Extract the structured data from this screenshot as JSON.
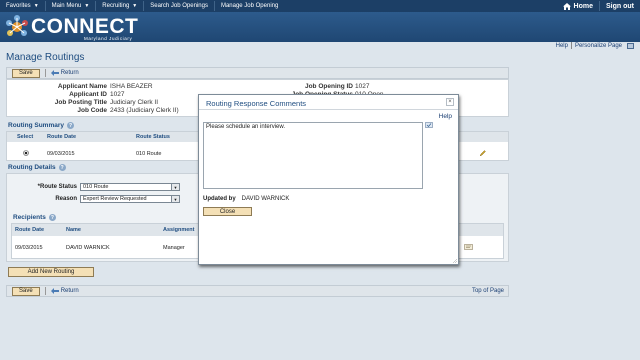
{
  "nav": {
    "items": [
      "Favorites",
      "Main Menu",
      "Recruiting",
      "Search Job Openings",
      "Manage Job Opening"
    ],
    "home": "Home",
    "signout": "Sign out"
  },
  "brand": {
    "name": "CONNECT",
    "sub": "Maryland Judiciary"
  },
  "help": {
    "help": "Help",
    "personalize": "Personalize Page"
  },
  "page_title": "Manage Routings",
  "toolbar": {
    "save": "Save",
    "return": "Return",
    "top_of_page": "Top of Page"
  },
  "applicant": {
    "name_label": "Applicant Name",
    "name": "ISHA BEAZER",
    "id_label": "Applicant ID",
    "id": "1027",
    "posting_label": "Job Posting Title",
    "posting": "Judiciary Clerk II",
    "code_label": "Job Code",
    "code": "2433 (Judiciary Clerk II)",
    "opening_id_label": "Job Opening ID",
    "opening_id": "1027",
    "opening_status_label": "Job Opening Status",
    "opening_status": "010 Open"
  },
  "routing_summary": {
    "title": "Routing Summary",
    "columns": [
      "Select",
      "Route Date",
      "Route Status"
    ],
    "row": {
      "date": "09/03/2015",
      "status": "010 Route"
    }
  },
  "routing_details": {
    "title": "Routing Details",
    "route_status_label": "*Route Status",
    "route_status": "010 Route",
    "reason_label": "Reason",
    "reason": "Expert Review Requested"
  },
  "recipients": {
    "title": "Recipients",
    "columns": [
      "Route Date",
      "Name",
      "Assignment"
    ],
    "row": {
      "date": "09/03/2015",
      "name": "DAVID WARNICK",
      "assignment": "Manager"
    }
  },
  "add_routing": "Add New Routing",
  "modal": {
    "title": "Routing Response Comments",
    "help": "Help",
    "comment": "Please schedule an interview.",
    "updated_by_label": "Updated by",
    "updated_by": "DAVID WARNICK",
    "close": "Close"
  }
}
